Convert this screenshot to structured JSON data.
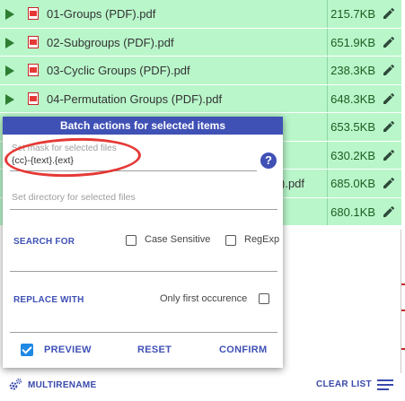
{
  "files": [
    {
      "name": "01-Groups (PDF).pdf",
      "size": "215.7KB"
    },
    {
      "name": "02-Subgroups (PDF).pdf",
      "size": "651.9KB"
    },
    {
      "name": "03-Cyclic Groups (PDF).pdf",
      "size": "238.3KB"
    },
    {
      "name": "04-Permutation Groups (PDF).pdf",
      "size": "648.3KB"
    },
    {
      "name": "",
      "size": "653.5KB"
    },
    {
      "name": "",
      "size": "630.2KB"
    },
    {
      "name": ").pdf",
      "size": "685.0KB"
    },
    {
      "name": "",
      "size": "680.1KB"
    }
  ],
  "dialog": {
    "title": "Batch actions for selected items",
    "mask_placeholder": "Set mask for selected files",
    "mask_value": "{cc}-{text}.{ext}",
    "directory_placeholder": "Set directory for selected files",
    "search_label": "SEARCH FOR",
    "case_sensitive_label": "Case Sensitive",
    "regexp_label": "RegExp",
    "replace_label": "REPLACE WITH",
    "first_occurence_label": "Only first occurence",
    "preview_label": "PREVIEW",
    "reset_label": "RESET",
    "confirm_label": "CONFIRM",
    "help_glyph": "?"
  },
  "footer": {
    "multirename_label": "MULTIRENAME",
    "clear_label": "CLEAR LIST"
  },
  "colors": {
    "row_bg": "#b9f6ca",
    "accent": "#3f51b5",
    "annotation": "#e53935"
  }
}
